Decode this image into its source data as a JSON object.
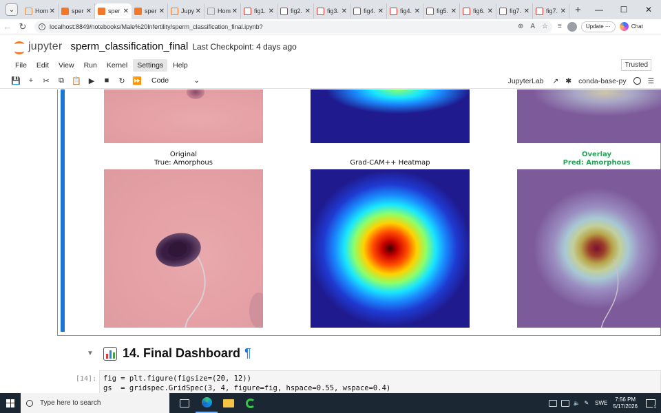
{
  "browser": {
    "tabs": [
      {
        "label": "Hom",
        "icon": "home-tab-icon",
        "active": false
      },
      {
        "label": "sper",
        "icon": "notebook-tab-icon",
        "active": false
      },
      {
        "label": "sper",
        "icon": "notebook-tab-icon",
        "active": true
      },
      {
        "label": "sper",
        "icon": "notebook-tab-icon",
        "active": false
      },
      {
        "label": "Jupy",
        "icon": "jupyter-tab-icon",
        "active": false
      },
      {
        "label": "Hom",
        "icon": "home-tab-icon",
        "active": false
      },
      {
        "label": "fig1.",
        "icon": "pdf-tab-icon",
        "active": false
      },
      {
        "label": "fig2.",
        "icon": "pdf-tab-icon",
        "active": false
      },
      {
        "label": "fig3.",
        "icon": "pdf-tab-icon",
        "active": false
      },
      {
        "label": "fig4.",
        "icon": "pdf-tab-icon",
        "active": false
      },
      {
        "label": "fig4.",
        "icon": "pdf-tab-icon",
        "active": false
      },
      {
        "label": "fig5.",
        "icon": "pdf-tab-icon",
        "active": false
      },
      {
        "label": "fig6.",
        "icon": "pdf-tab-icon",
        "active": false
      },
      {
        "label": "fig7.",
        "icon": "pdf-tab-icon",
        "active": false
      },
      {
        "label": "fig7.",
        "icon": "pdf-tab-icon",
        "active": false
      }
    ],
    "tab_close": "✕",
    "new_tab": "+",
    "url": "localhost:8849/notebooks/Male%20Infertility/sperm_classification_final.ipynb?",
    "update_label": "Update",
    "update_more": "···",
    "chat_label": "Chat"
  },
  "jupyter": {
    "logo_text": "jupyter",
    "notebook_title": "sperm_classification_final",
    "checkpoint": "Last Checkpoint: 4 days ago",
    "menu": [
      "File",
      "Edit",
      "View",
      "Run",
      "Kernel",
      "Settings",
      "Help"
    ],
    "highlighted_menu": "Settings",
    "trusted": "Trusted",
    "cell_type": "Code",
    "jupyterlab_link": "JupyterLab",
    "kernel_name": "conda-base-py"
  },
  "figure": {
    "original_title": "Original",
    "original_true": "True: Amorphous",
    "heatmap_title": "Grad-CAM++ Heatmap",
    "overlay_title": "Overlay",
    "overlay_pred": "Pred: Amorphous",
    "pred_color": "#27a35a"
  },
  "section": {
    "title": "14. Final Dashboard",
    "anchor": "¶"
  },
  "code_cell": {
    "prompt": "[14]:",
    "line1": "fig = plt.figure(figsize=(20, 12))",
    "line2": "gs  = gridspec.GridSpec(3, 4, figure=fig, hspace=0.55, wspace=0.4)"
  },
  "taskbar": {
    "search_placeholder": "Type here to search",
    "lang": "SWE",
    "time": "7:56 PM",
    "date": "5/17/2026",
    "notif_count": "1"
  },
  "colors": {
    "accent": "#1976d2",
    "jupyter_orange": "#f37726",
    "taskbar": "#1b2733"
  }
}
